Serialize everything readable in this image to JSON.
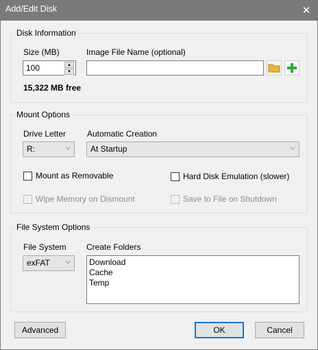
{
  "window": {
    "title": "Add/Edit Disk",
    "close_glyph": "✕"
  },
  "disk_info": {
    "group_label": "Disk Information",
    "size_label": "Size (MB)",
    "size_value": "100",
    "image_label": "Image File Name (optional)",
    "image_value": "",
    "free_space": "15,322 MB free"
  },
  "mount": {
    "group_label": "Mount Options",
    "drive_letter_label": "Drive Letter",
    "drive_letter_value": "R:",
    "auto_creation_label": "Automatic Creation",
    "auto_creation_value": "At Startup",
    "removable_label": "Mount as Removable",
    "hdd_emulation_label": "Hard Disk Emulation (slower)",
    "wipe_label": "Wipe Memory on Dismount",
    "save_label": "Save to File on Shutdown"
  },
  "fs": {
    "group_label": "File System Options",
    "fs_label": "File System",
    "fs_value": "exFAT",
    "folders_label": "Create Folders",
    "folders": [
      "Download",
      "Cache",
      "Temp"
    ]
  },
  "buttons": {
    "advanced": "Advanced",
    "ok": "OK",
    "cancel": "Cancel"
  },
  "colors": {
    "titlebar": "#7a7a7a",
    "default_button_border": "#0078d7",
    "add_icon": "#3aa63a",
    "folder_icon": "#e8b53a"
  }
}
